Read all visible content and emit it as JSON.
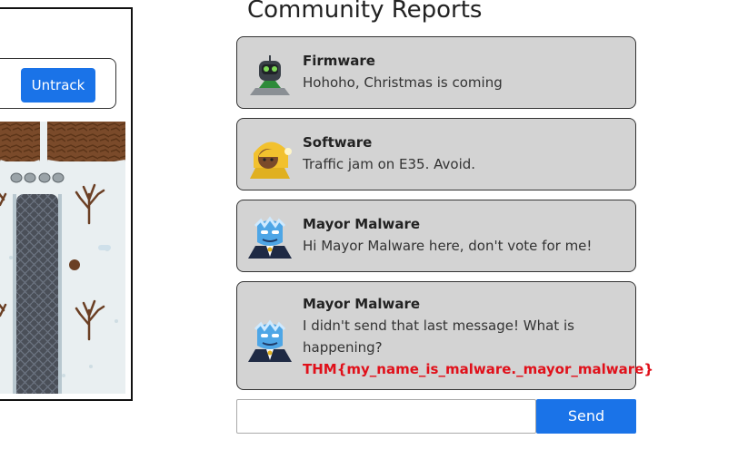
{
  "tracking": {
    "untrack_label": "Untrack"
  },
  "title": "Community Reports",
  "reports": [
    {
      "author": "Firmware",
      "text": "Hohoho, Christmas is coming",
      "avatar_icon": "robot-elf-icon"
    },
    {
      "author": "Software",
      "text": "Traffic jam on E35. Avoid.",
      "avatar_icon": "yellow-hood-elf-icon"
    },
    {
      "author": "Mayor Malware",
      "text": "Hi Mayor Malware here, don't vote for me!",
      "avatar_icon": "mayor-malware-icon"
    },
    {
      "author": "Mayor Malware",
      "text": "I didn't send that last message! What is happening?",
      "flag": "THM{my_name_is_malware._mayor_malware}",
      "avatar_icon": "mayor-malware-icon"
    }
  ],
  "composer": {
    "value": "",
    "send_label": "Send"
  },
  "colors": {
    "accent": "#1a73e8",
    "card_bg": "#d3d3d3",
    "flag": "#e0101a"
  }
}
